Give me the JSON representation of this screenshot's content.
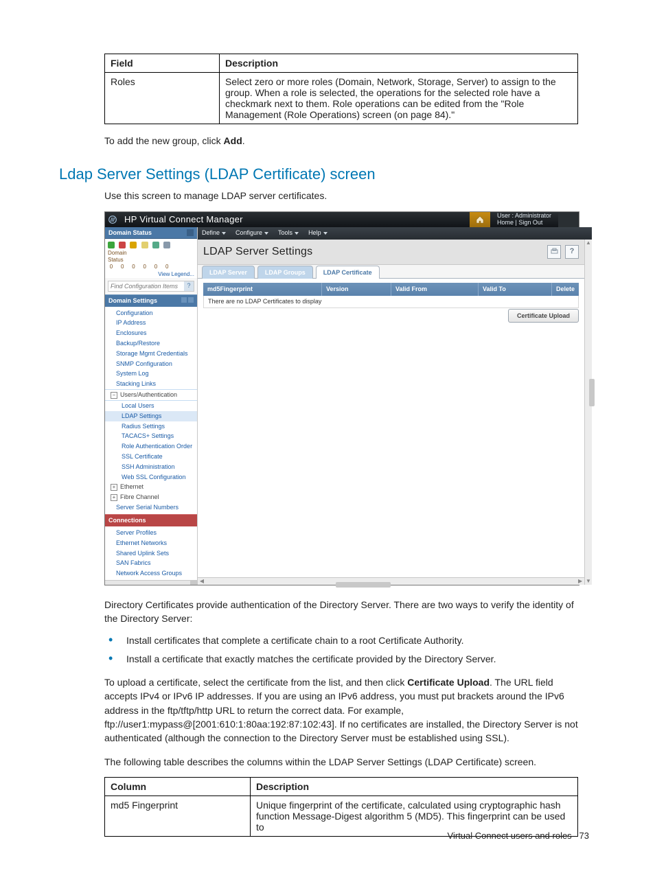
{
  "table1": {
    "headers": {
      "field": "Field",
      "description": "Description"
    },
    "row": {
      "field": "Roles",
      "description_pre": "Select zero or more roles (Domain, Network, Storage, Server) to assign to the group. When a role is selected, the operations for the selected role have a checkmark next to them. Role operations can be edited from the \"Role Management (Role Operations) screen (on page ",
      "page_link": "84",
      "description_post": ").\""
    }
  },
  "afterTable1_pre": "To add the new group, click ",
  "afterTable1_bold": "Add",
  "afterTable1_post": ".",
  "sectionTitle": "Ldap Server Settings (LDAP Certificate) screen",
  "introPara": "Use this screen to manage LDAP server certificates.",
  "screenshot": {
    "appTitle": "HP Virtual Connect Manager",
    "userLine1": "User : Administrator",
    "userLine2": "Home  |  Sign Out",
    "menubar": [
      "Define",
      "Configure",
      "Tools",
      "Help"
    ],
    "nav": {
      "domainStatusHeader": "Domain Status",
      "domainLabel": "Domain Status",
      "counts": [
        "0",
        "0",
        "0",
        "0",
        "0",
        "0"
      ],
      "viewLegend": "View Legend...",
      "findPlaceholder": "Find Configuration Items",
      "domainSettingsHeader": "Domain Settings",
      "domainSettings": [
        "Configuration",
        "IP Address",
        "Enclosures",
        "Backup/Restore",
        "Storage Mgmt Credentials",
        "SNMP Configuration",
        "System Log",
        "Stacking Links"
      ],
      "usersAuthGroup": "Users/Authentication",
      "usersAuthItems": [
        "Local Users",
        "LDAP Settings",
        "Radius Settings",
        "TACACS+ Settings",
        "Role Authentication Order",
        "SSL Certificate",
        "SSH Administration",
        "Web SSL Configuration"
      ],
      "ethernetGroup": "Ethernet",
      "fibreGroup": "Fibre Channel",
      "serverSerial": "Server Serial Numbers",
      "connectionsHeader": "Connections",
      "connectionItems": [
        "Server Profiles",
        "Ethernet Networks",
        "Shared Uplink Sets",
        "SAN Fabrics",
        "Network Access Groups"
      ]
    },
    "main": {
      "panelTitle": "LDAP Server Settings",
      "helpGlyph": "?",
      "tabs": [
        "LDAP Server",
        "LDAP Groups",
        "LDAP Certificate"
      ],
      "activeTabIndex": 2,
      "gridHeaders": {
        "md5": "md5Fingerprint",
        "version": "Version",
        "validFrom": "Valid From",
        "validTo": "Valid To",
        "delete": "Delete"
      },
      "emptyMsg": "There are no LDAP Certificates to display",
      "uploadBtn": "Certificate Upload"
    }
  },
  "afterShot1": "Directory Certificates provide authentication of the Directory Server. There are two ways to verify the identity of the Directory Server:",
  "bullets": [
    "Install certificates that complete a certificate chain to a root Certificate Authority.",
    "Install a certificate that exactly matches the certificate provided by the Directory Server."
  ],
  "afterBullets": {
    "pre": "To upload a certificate, select the certificate from the list, and then click ",
    "bold": "Certificate Upload",
    "post": ". The URL field accepts IPv4 or IPv6 IP addresses. If you are using an IPv6 address, you must put brackets around the IPv6 address in the ftp/tftp/http URL to return the correct data. For example, ftp://user1:mypass@[2001:610:1:80aa:192:87:102:43]. If no certificates are installed, the Directory Server is not authenticated (although the connection to the Directory Server must be established using SSL)."
  },
  "tableIntro": "The following table describes the columns within the LDAP Server Settings (LDAP Certificate) screen.",
  "table2": {
    "headers": {
      "column": "Column",
      "description": "Description"
    },
    "row": {
      "column": "md5 Fingerprint",
      "description": "Unique fingerprint of the certificate, calculated using cryptographic hash function Message-Digest algorithm 5 (MD5). This fingerprint can be used to"
    }
  },
  "footer": {
    "text": "Virtual Connect users and roles",
    "page": "73"
  }
}
